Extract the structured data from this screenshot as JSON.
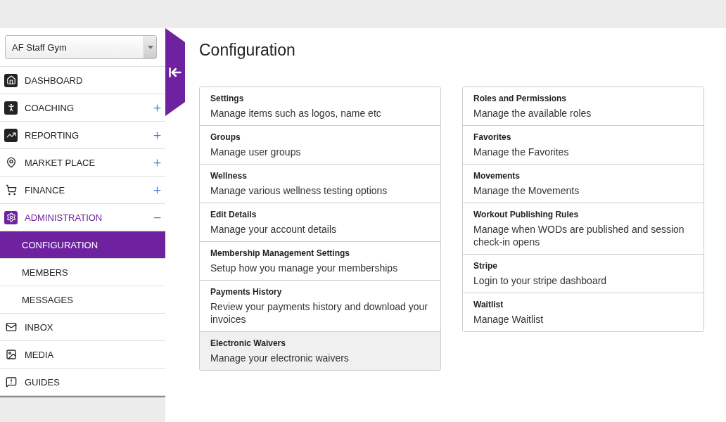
{
  "gym_select": {
    "value": "AF Staff Gym"
  },
  "nav": [
    {
      "label": "DASHBOARD",
      "selected": false
    },
    {
      "label": "COACHING",
      "selected": false,
      "expanded": false
    },
    {
      "label": "REPORTING",
      "selected": false,
      "expanded": false
    },
    {
      "label": "MARKET PLACE",
      "selected": false,
      "expanded": false
    },
    {
      "label": "FINANCE",
      "selected": false,
      "expanded": false
    },
    {
      "label": "ADMINISTRATION",
      "selected": true,
      "expanded": true,
      "children": [
        {
          "label": "CONFIGURATION",
          "selected": true
        },
        {
          "label": "MEMBERS",
          "selected": false
        },
        {
          "label": "MESSAGES",
          "selected": false
        }
      ]
    },
    {
      "label": "INBOX",
      "selected": false
    },
    {
      "label": "MEDIA",
      "selected": false
    },
    {
      "label": "GUIDES",
      "selected": false
    }
  ],
  "page_title": "Configuration",
  "columns": [
    [
      {
        "title": "Settings",
        "description": "Manage items such as logos, name etc",
        "highlighted": false
      },
      {
        "title": "Groups",
        "description": "Manage user groups",
        "highlighted": false
      },
      {
        "title": "Wellness",
        "description": "Manage various wellness testing options",
        "highlighted": false
      },
      {
        "title": "Edit Details",
        "description": "Manage your account details",
        "highlighted": false
      },
      {
        "title": "Membership Management Settings",
        "description": "Setup how you manage your memberships",
        "highlighted": false
      },
      {
        "title": "Payments History",
        "description": "Review your payments history and download your invoices",
        "highlighted": false
      },
      {
        "title": "Electronic Waivers",
        "description": "Manage your electronic waivers",
        "highlighted": true
      }
    ],
    [
      {
        "title": "Roles and Permissions",
        "description": "Manage the available roles",
        "highlighted": false
      },
      {
        "title": "Favorites",
        "description": "Manage the Favorites",
        "highlighted": false
      },
      {
        "title": "Movements",
        "description": "Manage the Movements",
        "highlighted": false
      },
      {
        "title": "Workout Publishing Rules",
        "description": "Manage when WODs are published and session check-in opens",
        "highlighted": false
      },
      {
        "title": "Stripe",
        "description": "Login to your stripe dashboard",
        "highlighted": false
      },
      {
        "title": "Waitlist",
        "description": "Manage Waitlist",
        "highlighted": false
      }
    ]
  ]
}
